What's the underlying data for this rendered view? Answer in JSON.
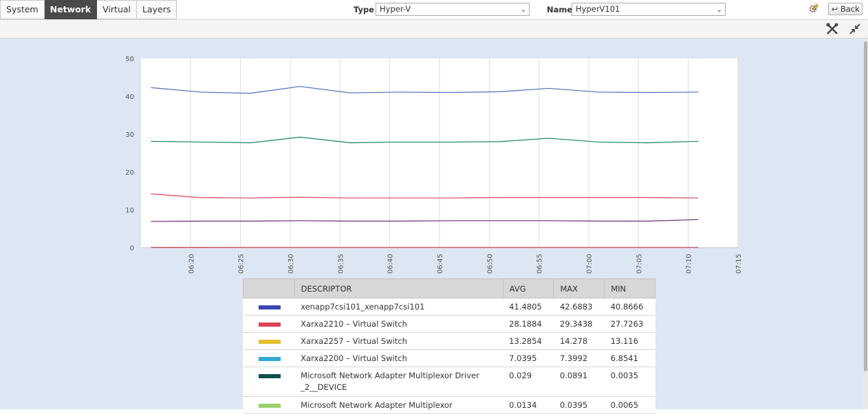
{
  "tabs": [
    {
      "label": "System",
      "active": false
    },
    {
      "label": "Network",
      "active": true
    },
    {
      "label": "Virtual",
      "active": false
    },
    {
      "label": "Layers",
      "active": false
    }
  ],
  "filters": {
    "type_label": "Type",
    "type_value": "Hyper-V",
    "name_label": "Name",
    "name_value": "HyperV101"
  },
  "header": {
    "back_label": "Back",
    "settings_icon": "wrench-screwdriver-icon",
    "collapse_icon": "collapse-icon",
    "edit_icon": "gear-pencil-icon"
  },
  "chart_data": {
    "type": "line",
    "ylim": [
      0,
      50
    ],
    "yticks": [
      "0",
      "10",
      "20",
      "30",
      "40",
      "50"
    ],
    "xticks": [
      "06:20",
      "06:25",
      "06:30",
      "06:35",
      "06:40",
      "06:45",
      "06:50",
      "06:55",
      "07:00",
      "07:05",
      "07:10",
      "07:15"
    ],
    "x": [
      "06:16",
      "06:21",
      "06:26",
      "06:31",
      "06:36",
      "06:41",
      "06:46",
      "06:51",
      "06:56",
      "07:01",
      "07:06",
      "07:11"
    ],
    "grid": true,
    "series": [
      {
        "color": "#4a72b8",
        "values": [
          42.3,
          41.1,
          40.8,
          42.6,
          40.9,
          41.1,
          41.0,
          41.2,
          42.1,
          41.1,
          41.0,
          41.1
        ]
      },
      {
        "color": "#14855f",
        "values": [
          28.1,
          27.9,
          27.7,
          29.2,
          27.7,
          27.9,
          27.9,
          28.0,
          28.9,
          27.9,
          27.7,
          28.1
        ]
      },
      {
        "color": "#e0405c",
        "values": [
          14.2,
          13.2,
          13.1,
          13.3,
          13.1,
          13.1,
          13.1,
          13.2,
          13.2,
          13.2,
          13.2,
          13.1
        ]
      },
      {
        "color": "#6a2c6e",
        "values": [
          6.9,
          7.0,
          7.0,
          7.1,
          7.0,
          7.0,
          7.1,
          7.1,
          7.1,
          7.0,
          7.0,
          7.4
        ]
      },
      {
        "color": "#1d5a57",
        "values": [
          0.05,
          0.04,
          0.03,
          0.03,
          0.03,
          0.02,
          0.02,
          0.03,
          0.03,
          0.02,
          0.02,
          0.03
        ]
      },
      {
        "color": "#e05050",
        "values": [
          0.02,
          0.02,
          0.01,
          0.01,
          0.01,
          0.01,
          0.01,
          0.01,
          0.01,
          0.01,
          0.01,
          0.01
        ]
      }
    ]
  },
  "table": {
    "headers": [
      "",
      "DESCRIPTOR",
      "AVG",
      "MAX",
      "MIN"
    ],
    "rows": [
      {
        "color": "#3b46b5",
        "descriptor": "xenapp7csi101_xenapp7csi101",
        "avg": "41.4805",
        "max": "42.6883",
        "min": "40.8666"
      },
      {
        "color": "#e04052",
        "descriptor": "Xarxa2210 – Virtual Switch",
        "avg": "28.1884",
        "max": "29.3438",
        "min": "27.7263"
      },
      {
        "color": "#e3c22c",
        "descriptor": "Xarxa2257 – Virtual Switch",
        "avg": "13.2854",
        "max": "14.278",
        "min": "13.116"
      },
      {
        "color": "#32a9d6",
        "descriptor": "Xarxa2200 – Virtual Switch",
        "avg": "7.0395",
        "max": "7.3992",
        "min": "6.8541"
      },
      {
        "color": "#0f4f4a",
        "descriptor": "Microsoft Network Adapter Multiplexor Driver _2__DEVICE",
        "avg": "0.029",
        "max": "0.0891",
        "min": "0.0035"
      },
      {
        "color": "#9ad16a",
        "descriptor": "Microsoft Network Adapter Multiplexor",
        "avg": "0.0134",
        "max": "0.0395",
        "min": "0.0065"
      }
    ]
  }
}
